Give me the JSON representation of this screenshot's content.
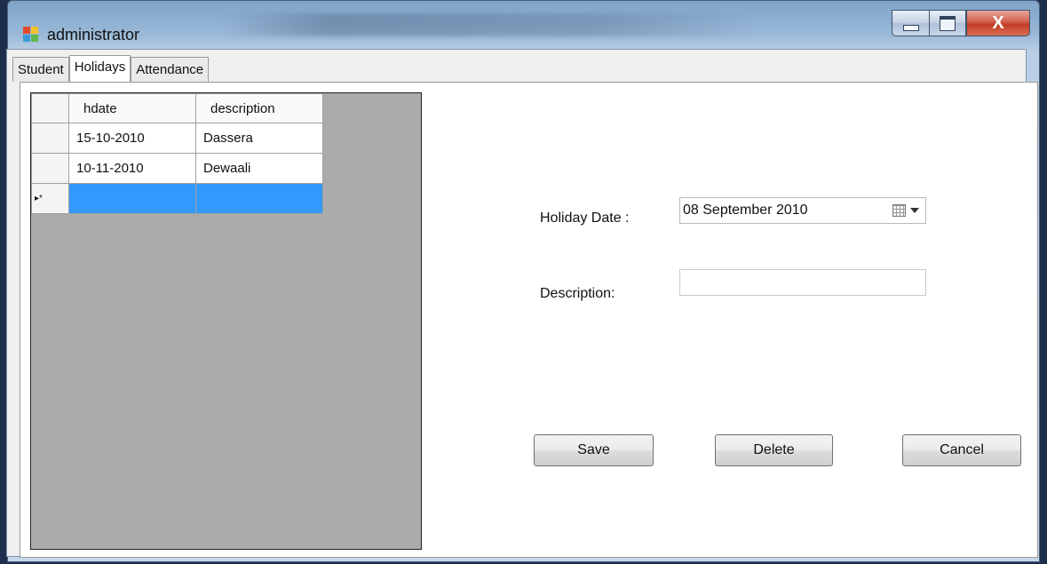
{
  "window": {
    "title": "administrator",
    "close_glyph": "X"
  },
  "tabs": [
    {
      "label": "Student",
      "active": false
    },
    {
      "label": "Holidays",
      "active": true
    },
    {
      "label": "Attendance",
      "active": false
    }
  ],
  "grid": {
    "columns": [
      "hdate",
      "description"
    ],
    "rows": [
      {
        "hdate": "15-10-2010",
        "description": "Dassera"
      },
      {
        "hdate": "10-11-2010",
        "description": "Dewaali"
      }
    ],
    "new_row_indicator": "▸*"
  },
  "form": {
    "holiday_date_label": "Holiday Date :",
    "holiday_date_value": "08 September 2010",
    "description_label": "Description:",
    "description_value": ""
  },
  "buttons": {
    "save": "Save",
    "delete": "Delete",
    "cancel": "Cancel"
  },
  "icons": {
    "app": "application-icon",
    "calendar": "calendar-icon",
    "dropdown": "chevron-down-icon"
  },
  "colors": {
    "selection": "#3399ff",
    "grid_background": "#ababab",
    "close_button": "#c23a22"
  }
}
